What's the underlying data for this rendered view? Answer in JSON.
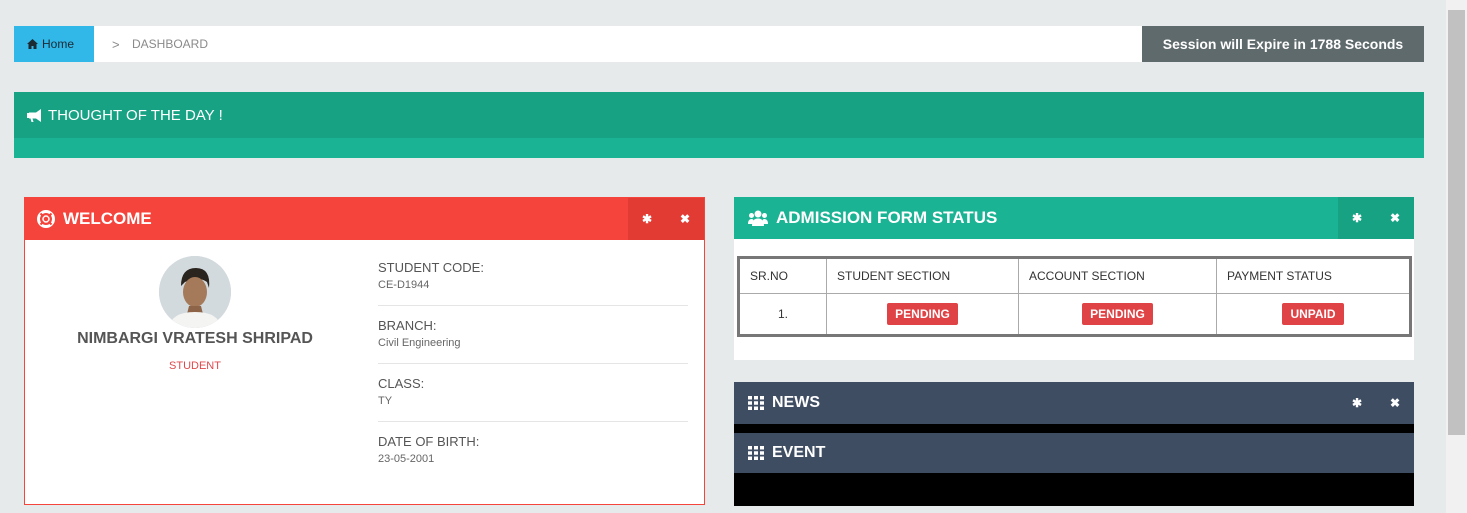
{
  "breadcrumb": {
    "home_label": "Home",
    "separator": ">",
    "current": "DASHBOARD"
  },
  "session": {
    "text": "Session will Expire in 1788 Seconds"
  },
  "thought": {
    "title": "THOUGHT OF THE DAY !"
  },
  "welcome": {
    "title": "WELCOME",
    "student_name": "NIMBARGI VRATESH SHRIPAD",
    "role": "STUDENT",
    "fields": [
      {
        "label": "STUDENT CODE:",
        "value": "CE-D1944"
      },
      {
        "label": "BRANCH:",
        "value": "Civil Engineering"
      },
      {
        "label": "CLASS:",
        "value": "TY"
      },
      {
        "label": "DATE OF BIRTH:",
        "value": "23-05-2001"
      }
    ]
  },
  "admission": {
    "title": "ADMISSION FORM STATUS",
    "headers": [
      "SR.NO",
      "STUDENT SECTION",
      "ACCOUNT SECTION",
      "PAYMENT STATUS"
    ],
    "row": {
      "sr": "1.",
      "student_section": "PENDING",
      "account_section": "PENDING",
      "payment_status": "UNPAID"
    }
  },
  "news": {
    "title": "NEWS"
  },
  "event": {
    "title": "EVENT"
  },
  "icons": {
    "home": "home-icon",
    "bullhorn": "bullhorn-icon",
    "lifebuoy": "lifebuoy-icon",
    "users": "users-icon",
    "grid": "grid-icon",
    "gear": "gear-icon",
    "close": "close-icon"
  },
  "colors": {
    "home": "#31b7e8",
    "session": "#5f6a6d",
    "green": "#1ab394",
    "red": "#f5443c",
    "navy": "#3f4d63",
    "badge": "#e04346"
  }
}
